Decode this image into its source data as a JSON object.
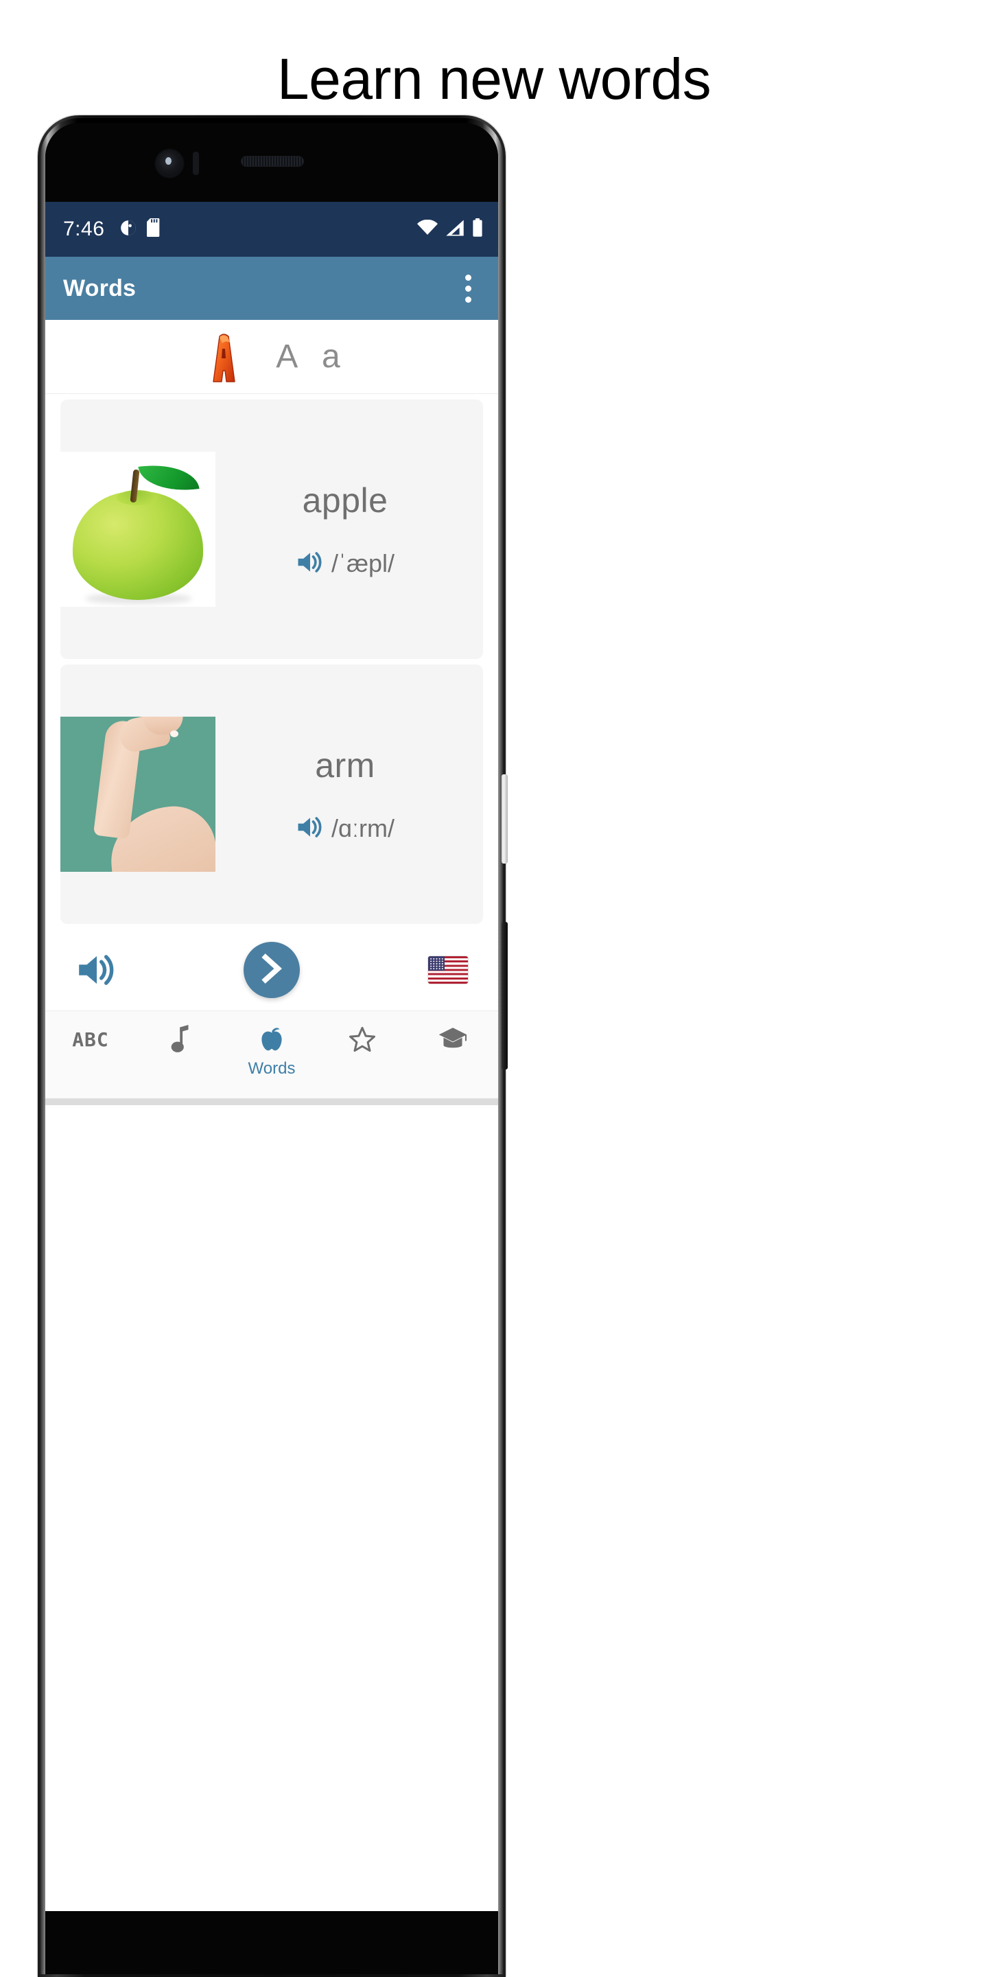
{
  "page": {
    "heading": "Learn new words"
  },
  "status_bar": {
    "time": "7:46",
    "left_icons": [
      "do-not-disturb-icon",
      "sd-card-icon"
    ],
    "right_icons": [
      "wifi-icon",
      "cellular-signal-icon",
      "battery-icon"
    ],
    "background_color": "#1d3557"
  },
  "app_bar": {
    "title": "Words",
    "overflow_menu_label": "More options",
    "background_color": "#4a7fa1"
  },
  "letter_header": {
    "letter_image_alt": "A",
    "letter_pair": "A a"
  },
  "words": [
    {
      "word": "apple",
      "phonetic": "/ˈæpl/",
      "image_alt": "green apple",
      "speaker_icon": "speaker-icon"
    },
    {
      "word": "arm",
      "phonetic": "/ɑːrm/",
      "image_alt": "raised human arm on teal background",
      "speaker_icon": "speaker-icon"
    }
  ],
  "action_bar": {
    "speak_all_label": "Play all",
    "next_label": "Next",
    "language_label": "English (US)",
    "fab_color": "#4a7fa1"
  },
  "bottom_nav": {
    "active_index": 2,
    "items": [
      {
        "label": "",
        "icon": "abc-icon",
        "icon_text": "ABC"
      },
      {
        "label": "",
        "icon": "music-note-icon",
        "icon_text": ""
      },
      {
        "label": "Words",
        "icon": "apple-icon",
        "icon_text": ""
      },
      {
        "label": "",
        "icon": "star-icon",
        "icon_text": ""
      },
      {
        "label": "",
        "icon": "graduation-cap-icon",
        "icon_text": ""
      }
    ],
    "active_color": "#3f7fa6",
    "inactive_color": "#6e6e6e"
  }
}
